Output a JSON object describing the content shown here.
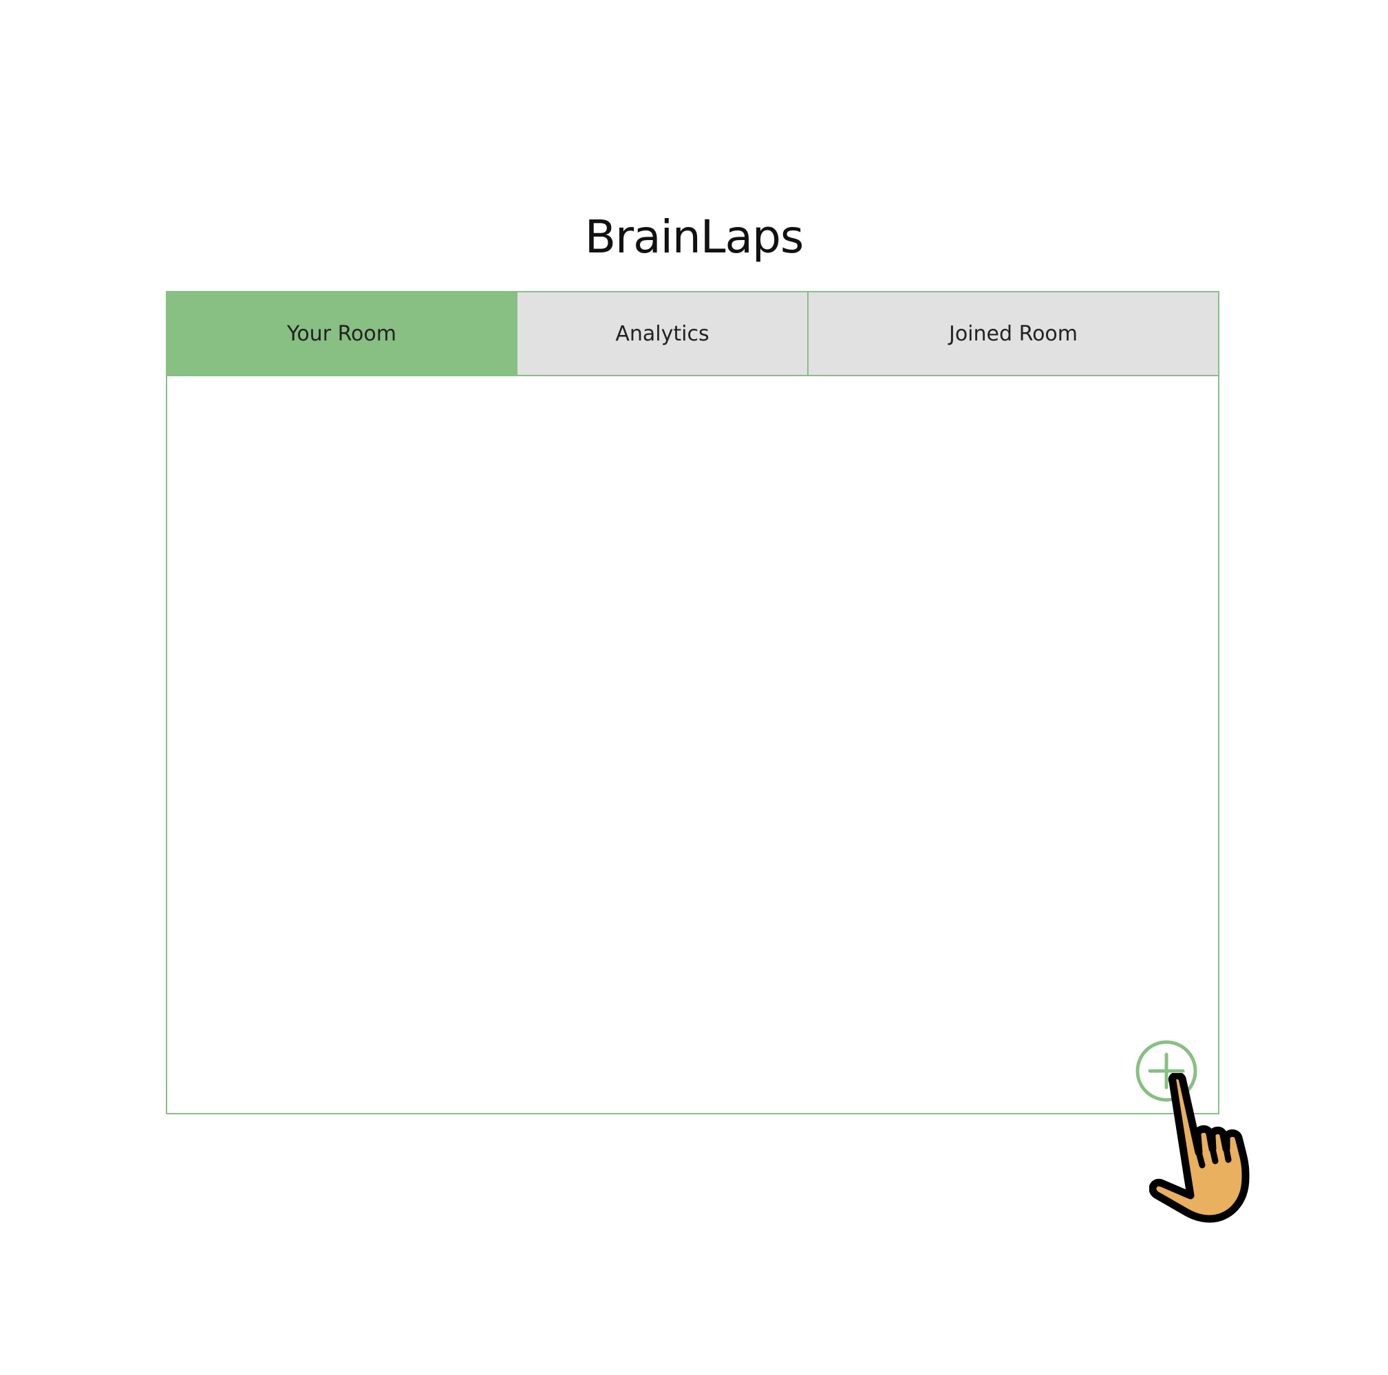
{
  "app": {
    "title": "BrainLaps"
  },
  "tabs": {
    "your_room": "Your Room",
    "analytics": "Analytics",
    "joined_room": "Joined Room",
    "active": "Your Room"
  },
  "content": {
    "add_button_icon": "plus-circle-icon",
    "pointer_icon": "hand-pointer-icon"
  },
  "colors": {
    "accent_green": "#88bf83",
    "tab_inactive": "#e1e1e1",
    "border_green": "#87bf84",
    "hand_fill": "#e8b05f"
  }
}
